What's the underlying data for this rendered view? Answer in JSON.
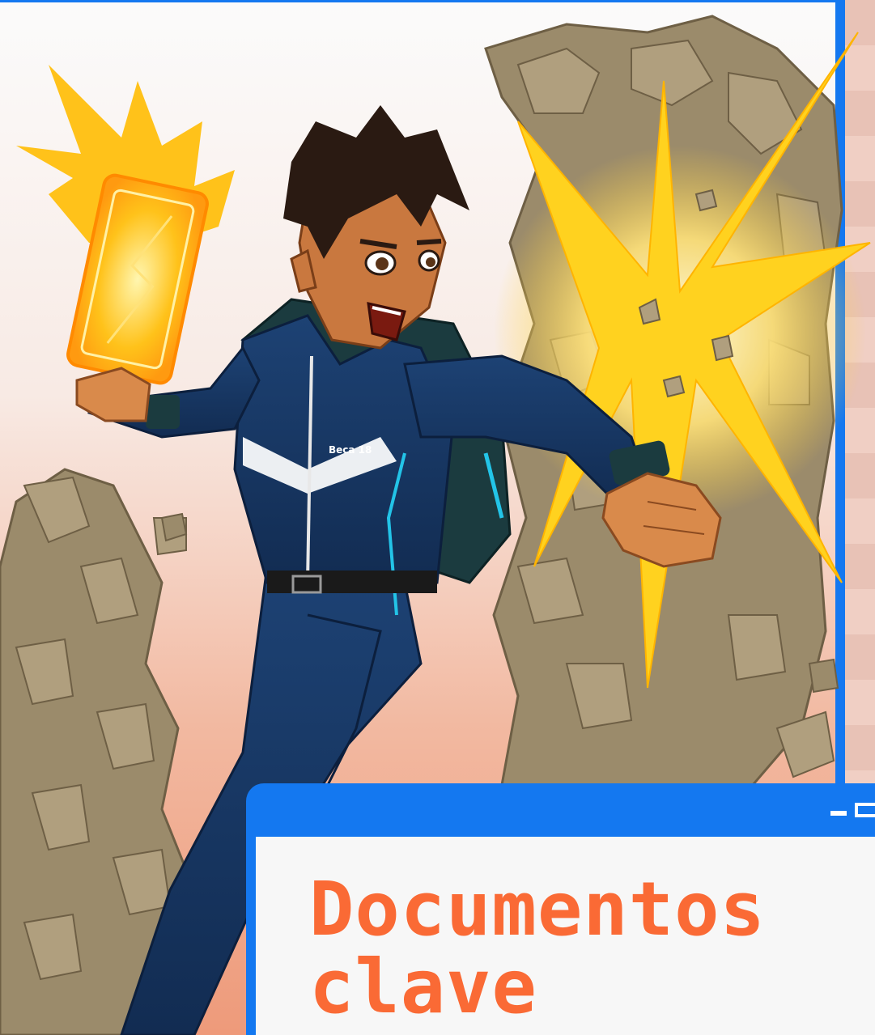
{
  "document_window": {
    "title_line1": "Documentos",
    "title_line2": "clave"
  },
  "hero": {
    "badge_text": "Beca 18"
  },
  "colors": {
    "accent_blue": "#1478f0",
    "title_orange": "#fa6a35",
    "jacket_navy": "#1a3a6a",
    "glow_yellow": "#ffc21a",
    "rock": "#9a8a6c"
  },
  "icons": [
    "minimize-icon",
    "maximize-icon"
  ]
}
